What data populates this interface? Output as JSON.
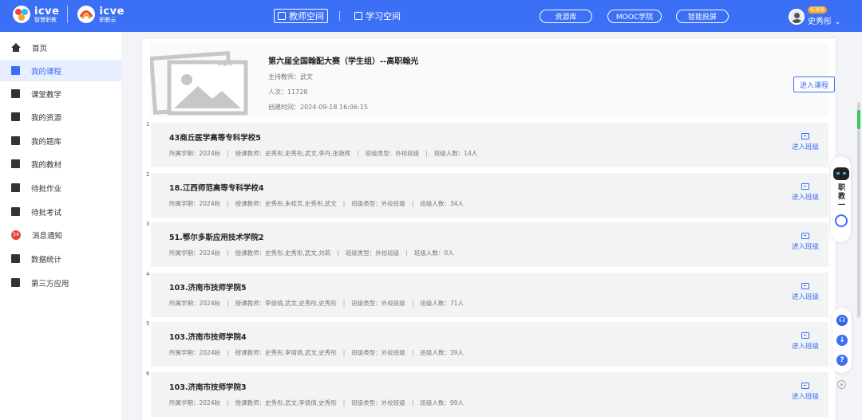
{
  "header": {
    "logo_left": {
      "name": "icve",
      "sub": "智慧职教"
    },
    "logo_right": {
      "name": "icve",
      "sub": "职教云"
    },
    "tabs": [
      {
        "label": "教师空间",
        "active": true
      },
      {
        "label": "学习空间",
        "active": false
      }
    ],
    "links": [
      "资源库",
      "MOOC学院",
      "智能投屏"
    ],
    "user": {
      "badge": "标准版",
      "name": "史秀彤"
    }
  },
  "sidebar": {
    "items": [
      {
        "label": "首页",
        "icon": "home-icon",
        "active": false
      },
      {
        "label": "我的课程",
        "icon": "book-icon",
        "active": true
      },
      {
        "label": "课堂教学",
        "icon": "play-icon",
        "active": false
      },
      {
        "label": "我的资源",
        "icon": "library-icon",
        "active": false
      },
      {
        "label": "我的题库",
        "icon": "question-bank-icon",
        "active": false
      },
      {
        "label": "我的教材",
        "icon": "textbook-icon",
        "active": false
      },
      {
        "label": "待批作业",
        "icon": "homework-icon",
        "active": false
      },
      {
        "label": "待批考试",
        "icon": "exam-icon",
        "active": false
      },
      {
        "label": "消息通知",
        "icon": "message-icon",
        "active": false,
        "count": "54"
      },
      {
        "label": "数据统计",
        "icon": "chart-icon",
        "active": false
      },
      {
        "label": "第三方应用",
        "icon": "apps-icon",
        "active": false
      }
    ]
  },
  "course": {
    "title": "第六届全国翰配大赛（学生组）--高职翰光",
    "teacher": "主持教师：武文",
    "visits": "人次：11728",
    "created": "创建时间：2024-09-18 16:06:15",
    "enter_label": "进入课程"
  },
  "classes": [
    {
      "num": "1",
      "name": "43商丘医学高等专科学校5",
      "term": "所属学期：2024秋",
      "teachers": "授课教师：史秀彤,史秀彤,武文,李丹,张艳辉",
      "type": "班级类型：外校班级",
      "count": "班级人数：14人",
      "enter": "进入班级"
    },
    {
      "num": "2",
      "name": "18.江西师范高等专科学校4",
      "term": "所属学期：2024秋",
      "teachers": "授课教师：史秀彤,朱桂芳,史秀彤,武文",
      "type": "班级类型：外校班级",
      "count": "班级人数：34人",
      "enter": "进入班级"
    },
    {
      "num": "3",
      "name": "51.鄂尔多斯应用技术学院2",
      "term": "所属学期：2024秋",
      "teachers": "授课教师：史秀彤,史秀彤,武文,刘莉",
      "type": "班级类型：外校班级",
      "count": "班级人数：0人",
      "enter": "进入班级"
    },
    {
      "num": "4",
      "name": "103.济南市技师学院5",
      "term": "所属学期：2024秋",
      "teachers": "授课教师：李倩倩,武文,史秀彤,史秀彤",
      "type": "班级类型：外校班级",
      "count": "班级人数：71人",
      "enter": "进入班级"
    },
    {
      "num": "5",
      "name": "103.济南市技师学院4",
      "term": "所属学期：2024秋",
      "teachers": "授课教师：史秀彤,李倩倩,武文,史秀彤",
      "type": "班级类型：外校班级",
      "count": "班级人数：39人",
      "enter": "进入班级"
    },
    {
      "num": "6",
      "name": "103.济南市技师学院3",
      "term": "所属学期：2024秋",
      "teachers": "授课教师：史秀彤,武文,李倩倩,史秀彤",
      "type": "班级类型：外校班级",
      "count": "班级人数：99人",
      "enter": "进入班级"
    }
  ],
  "widgets": {
    "ai_label": "职教一",
    "help": "?",
    "colors": {
      "primary": "#3b6ff5",
      "accent": "#35c85a",
      "alert": "#e8463b"
    }
  }
}
